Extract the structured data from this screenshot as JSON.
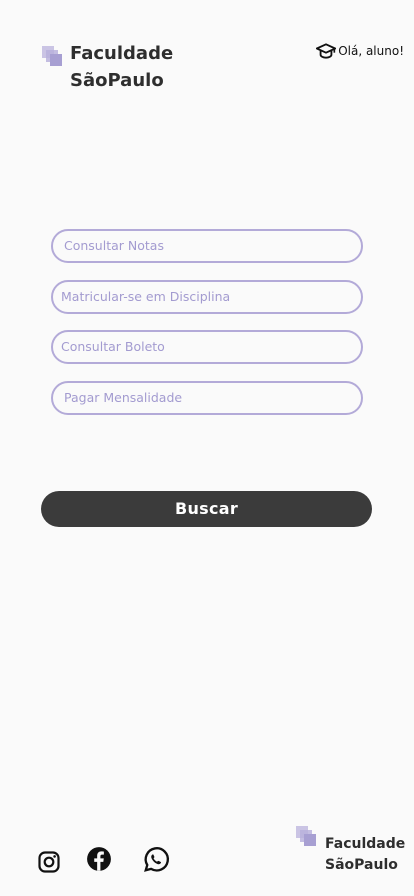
{
  "header": {
    "brand_line1": "Faculdade",
    "brand_line2": "SãoPaulo",
    "greeting": "Olá, aluno!",
    "greeting_icon": "graduation-cap-icon",
    "logo_icon": "stacked-squares-logo"
  },
  "form": {
    "fields": [
      {
        "placeholder": "Consultar Notas"
      },
      {
        "placeholder": "Matricular-se em Disciplina"
      },
      {
        "placeholder": "Consultar Boleto"
      },
      {
        "placeholder": "Pagar Mensalidade"
      }
    ],
    "search_label": "Buscar"
  },
  "footer": {
    "brand_line1": "Faculdade",
    "brand_line2": "SãoPaulo",
    "social_icons": [
      "instagram-icon",
      "facebook-icon",
      "whatsapp-icon"
    ]
  },
  "colors": {
    "accent": "#b3aad8",
    "button_bg": "#3b3b3b",
    "background": "#fafafa"
  }
}
